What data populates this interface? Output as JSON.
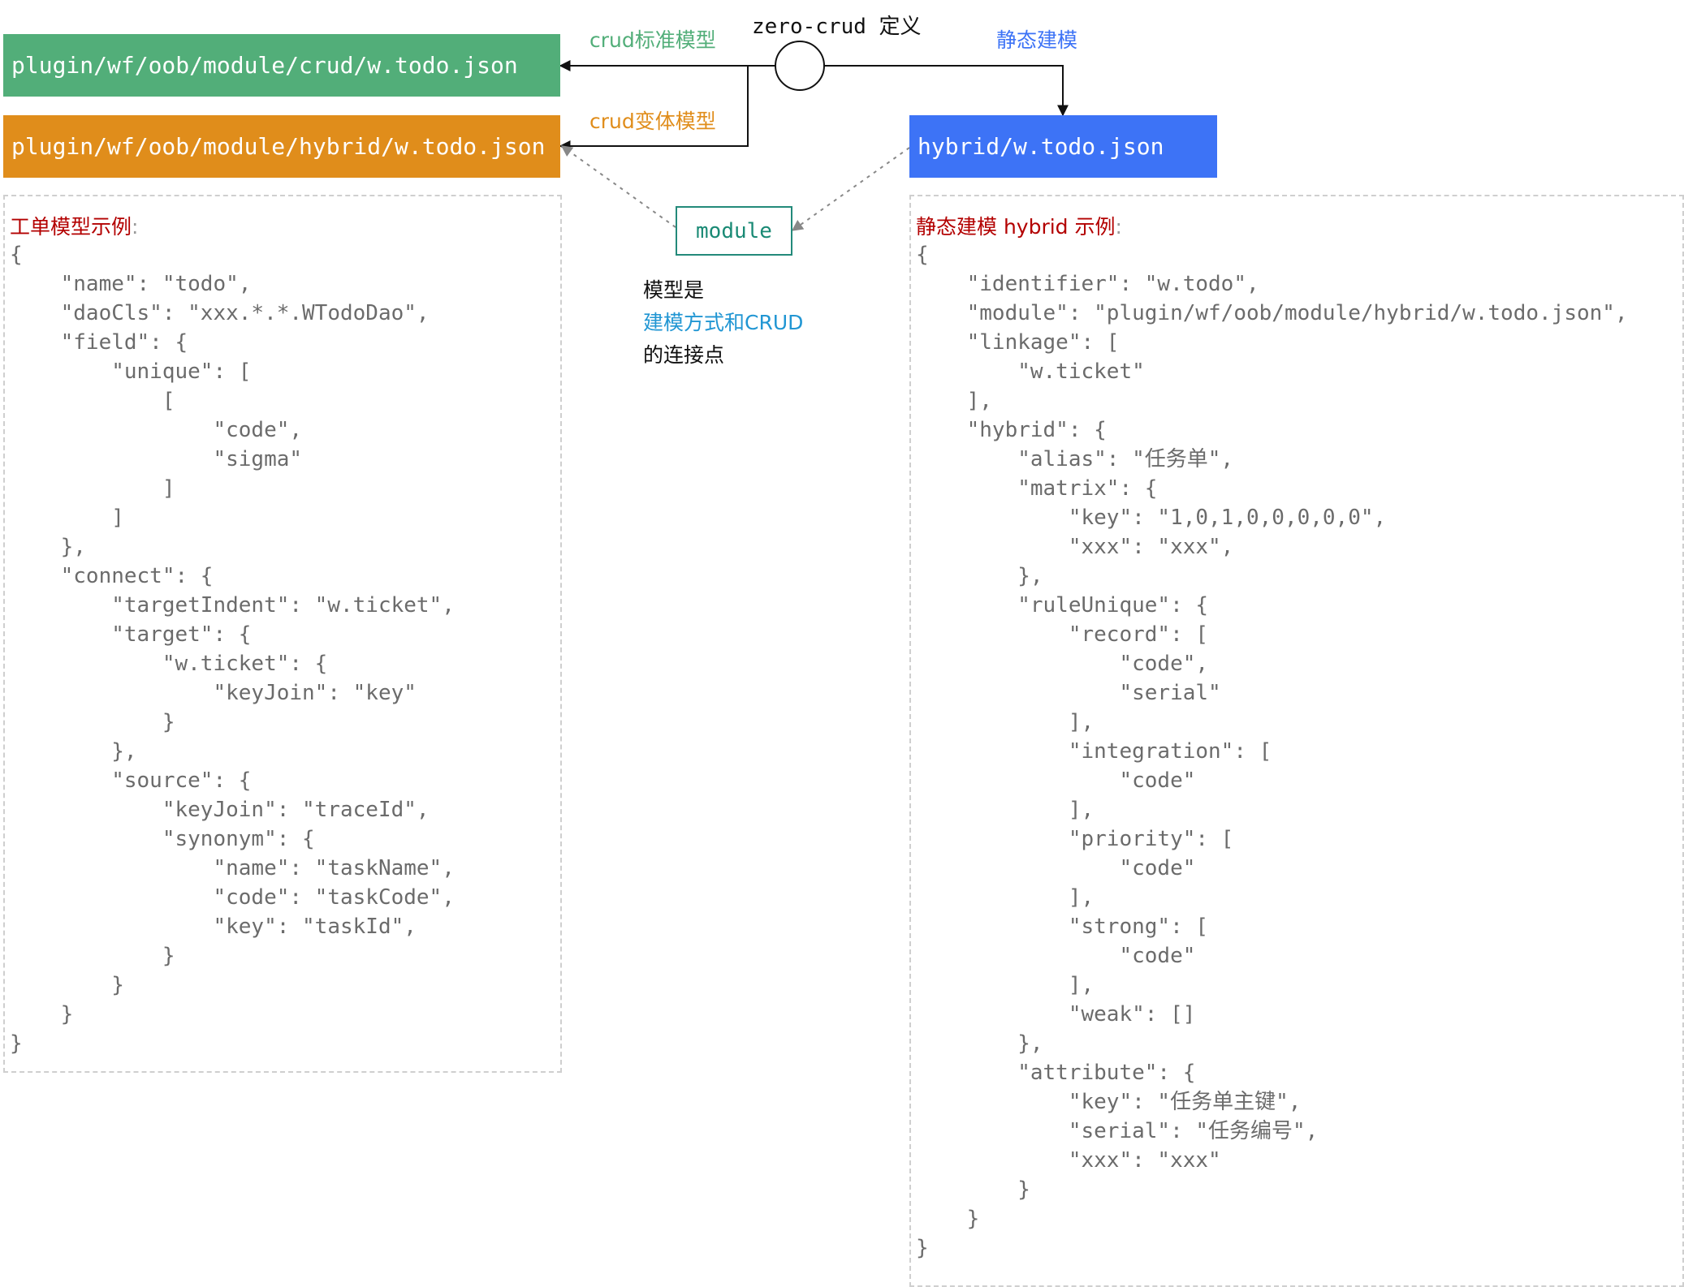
{
  "nodes": {
    "crud_path": "plugin/wf/oob/module/crud/w.todo.json",
    "hybrid_path": "plugin/wf/oob/module/hybrid/w.todo.json",
    "static_path": "hybrid/w.todo.json",
    "module": "module",
    "zero_crud": "zero-crud 定义"
  },
  "edges": {
    "crud_standard": "crud标准模型",
    "crud_variant": "crud变体模型",
    "static_modeling": "静态建模"
  },
  "note": {
    "line1": "模型是",
    "line2": "建模方式和CRUD",
    "line3": "的连接点"
  },
  "left_panel": {
    "title": "工单模型示例",
    "title_suffix": ":",
    "code": "{\n    \"name\": \"todo\",\n    \"daoCls\": \"xxx.*.*.WTodoDao\",\n    \"field\": {\n        \"unique\": [\n            [\n                \"code\",\n                \"sigma\"\n            ]\n        ]\n    },\n    \"connect\": {\n        \"targetIndent\": \"w.ticket\",\n        \"target\": {\n            \"w.ticket\": {\n                \"keyJoin\": \"key\"\n            }\n        },\n        \"source\": {\n            \"keyJoin\": \"traceId\",\n            \"synonym\": {\n                \"name\": \"taskName\",\n                \"code\": \"taskCode\",\n                \"key\": \"taskId\",\n            }\n        }\n    }\n}"
  },
  "right_panel": {
    "title": "静态建模 hybrid 示例",
    "title_suffix": ":",
    "code": "{\n    \"identifier\": \"w.todo\",\n    \"module\": \"plugin/wf/oob/module/hybrid/w.todo.json\",\n    \"linkage\": [\n        \"w.ticket\"\n    ],\n    \"hybrid\": {\n        \"alias\": \"任务单\",\n        \"matrix\": {\n            \"key\": \"1,0,1,0,0,0,0,0\",\n            \"xxx\": \"xxx\",\n        },\n        \"ruleUnique\": {\n            \"record\": [\n                \"code\",\n                \"serial\"\n            ],\n            \"integration\": [\n                \"code\"\n            ],\n            \"priority\": [\n                \"code\"\n            ],\n            \"strong\": [\n                \"code\"\n            ],\n            \"weak\": []\n        },\n        \"attribute\": {\n            \"key\": \"任务单主键\",\n            \"serial\": \"任务编号\",\n            \"xxx\": \"xxx\"\n        }\n    }\n}"
  },
  "colors": {
    "crud_green": "#52ae79",
    "hybrid_orange": "#e08d1b",
    "static_blue": "#3d73f6",
    "module_teal": "#238a7a",
    "title_red": "#b30000",
    "note_blue": "#2196d3"
  }
}
